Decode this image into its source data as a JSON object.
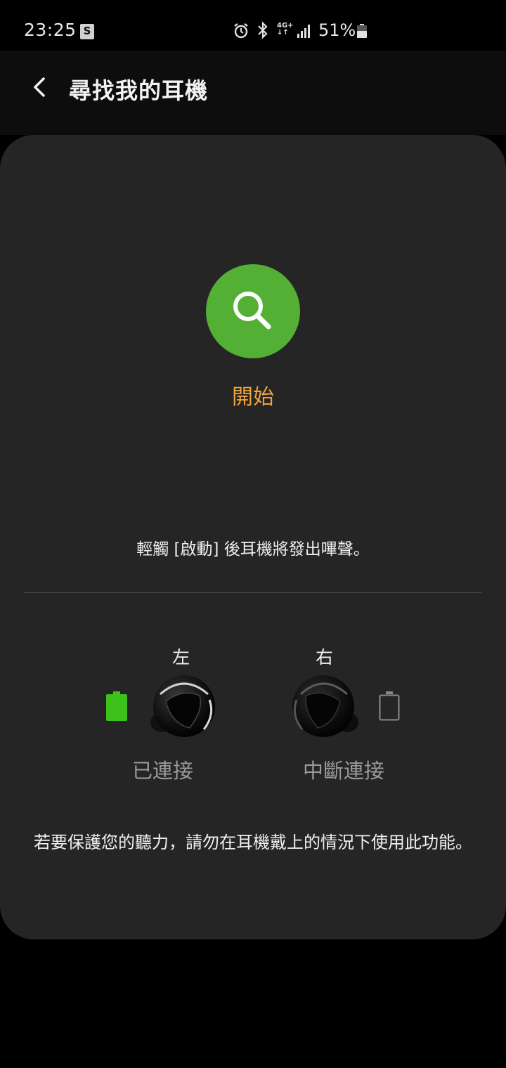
{
  "status_bar": {
    "time": "23:25",
    "store_icon_letter": "S",
    "network": "4G+",
    "battery_percent": "51%"
  },
  "app_bar": {
    "title": "尋找我的耳機",
    "back_icon": "chevron-left-icon"
  },
  "start": {
    "icon": "search-icon",
    "color": "#53b035",
    "label": "開始",
    "label_color": "#f3a33a"
  },
  "hint": "輕觸 [啟動] 後耳機將發出嗶聲。",
  "earbuds": {
    "left": {
      "label": "左",
      "status": "已連接",
      "battery": "full",
      "battery_color": "#3dc21b"
    },
    "right": {
      "label": "右",
      "status": "中斷連接",
      "battery": "empty"
    }
  },
  "warning": "若要保護您的聽力，請勿在耳機戴上的情況下使用此功能。"
}
